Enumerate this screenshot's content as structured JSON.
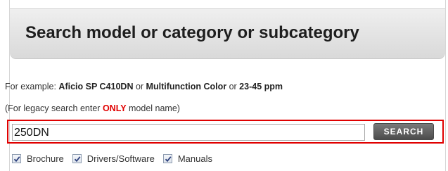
{
  "header": {
    "title": "Search model or category or subcategory"
  },
  "hint": {
    "prefix": "For example: ",
    "example1": "Aficio SP C410DN",
    "or1": " or ",
    "example2": "Multifunction Color",
    "or2": " or ",
    "example3": "23-45 ppm"
  },
  "legacy": {
    "prefix": "(For legacy search enter ",
    "emphasis": "ONLY",
    "suffix": " model name)"
  },
  "search": {
    "value": "250DN",
    "button_label": "SEARCH"
  },
  "filters": [
    {
      "label": "Brochure",
      "checked": true
    },
    {
      "label": "Drivers/Software",
      "checked": true
    },
    {
      "label": "Manuals",
      "checked": true
    }
  ],
  "colors": {
    "highlight_border": "#e00000",
    "emphasis_text": "#e10000",
    "button_bg": "#5c5c5c"
  }
}
